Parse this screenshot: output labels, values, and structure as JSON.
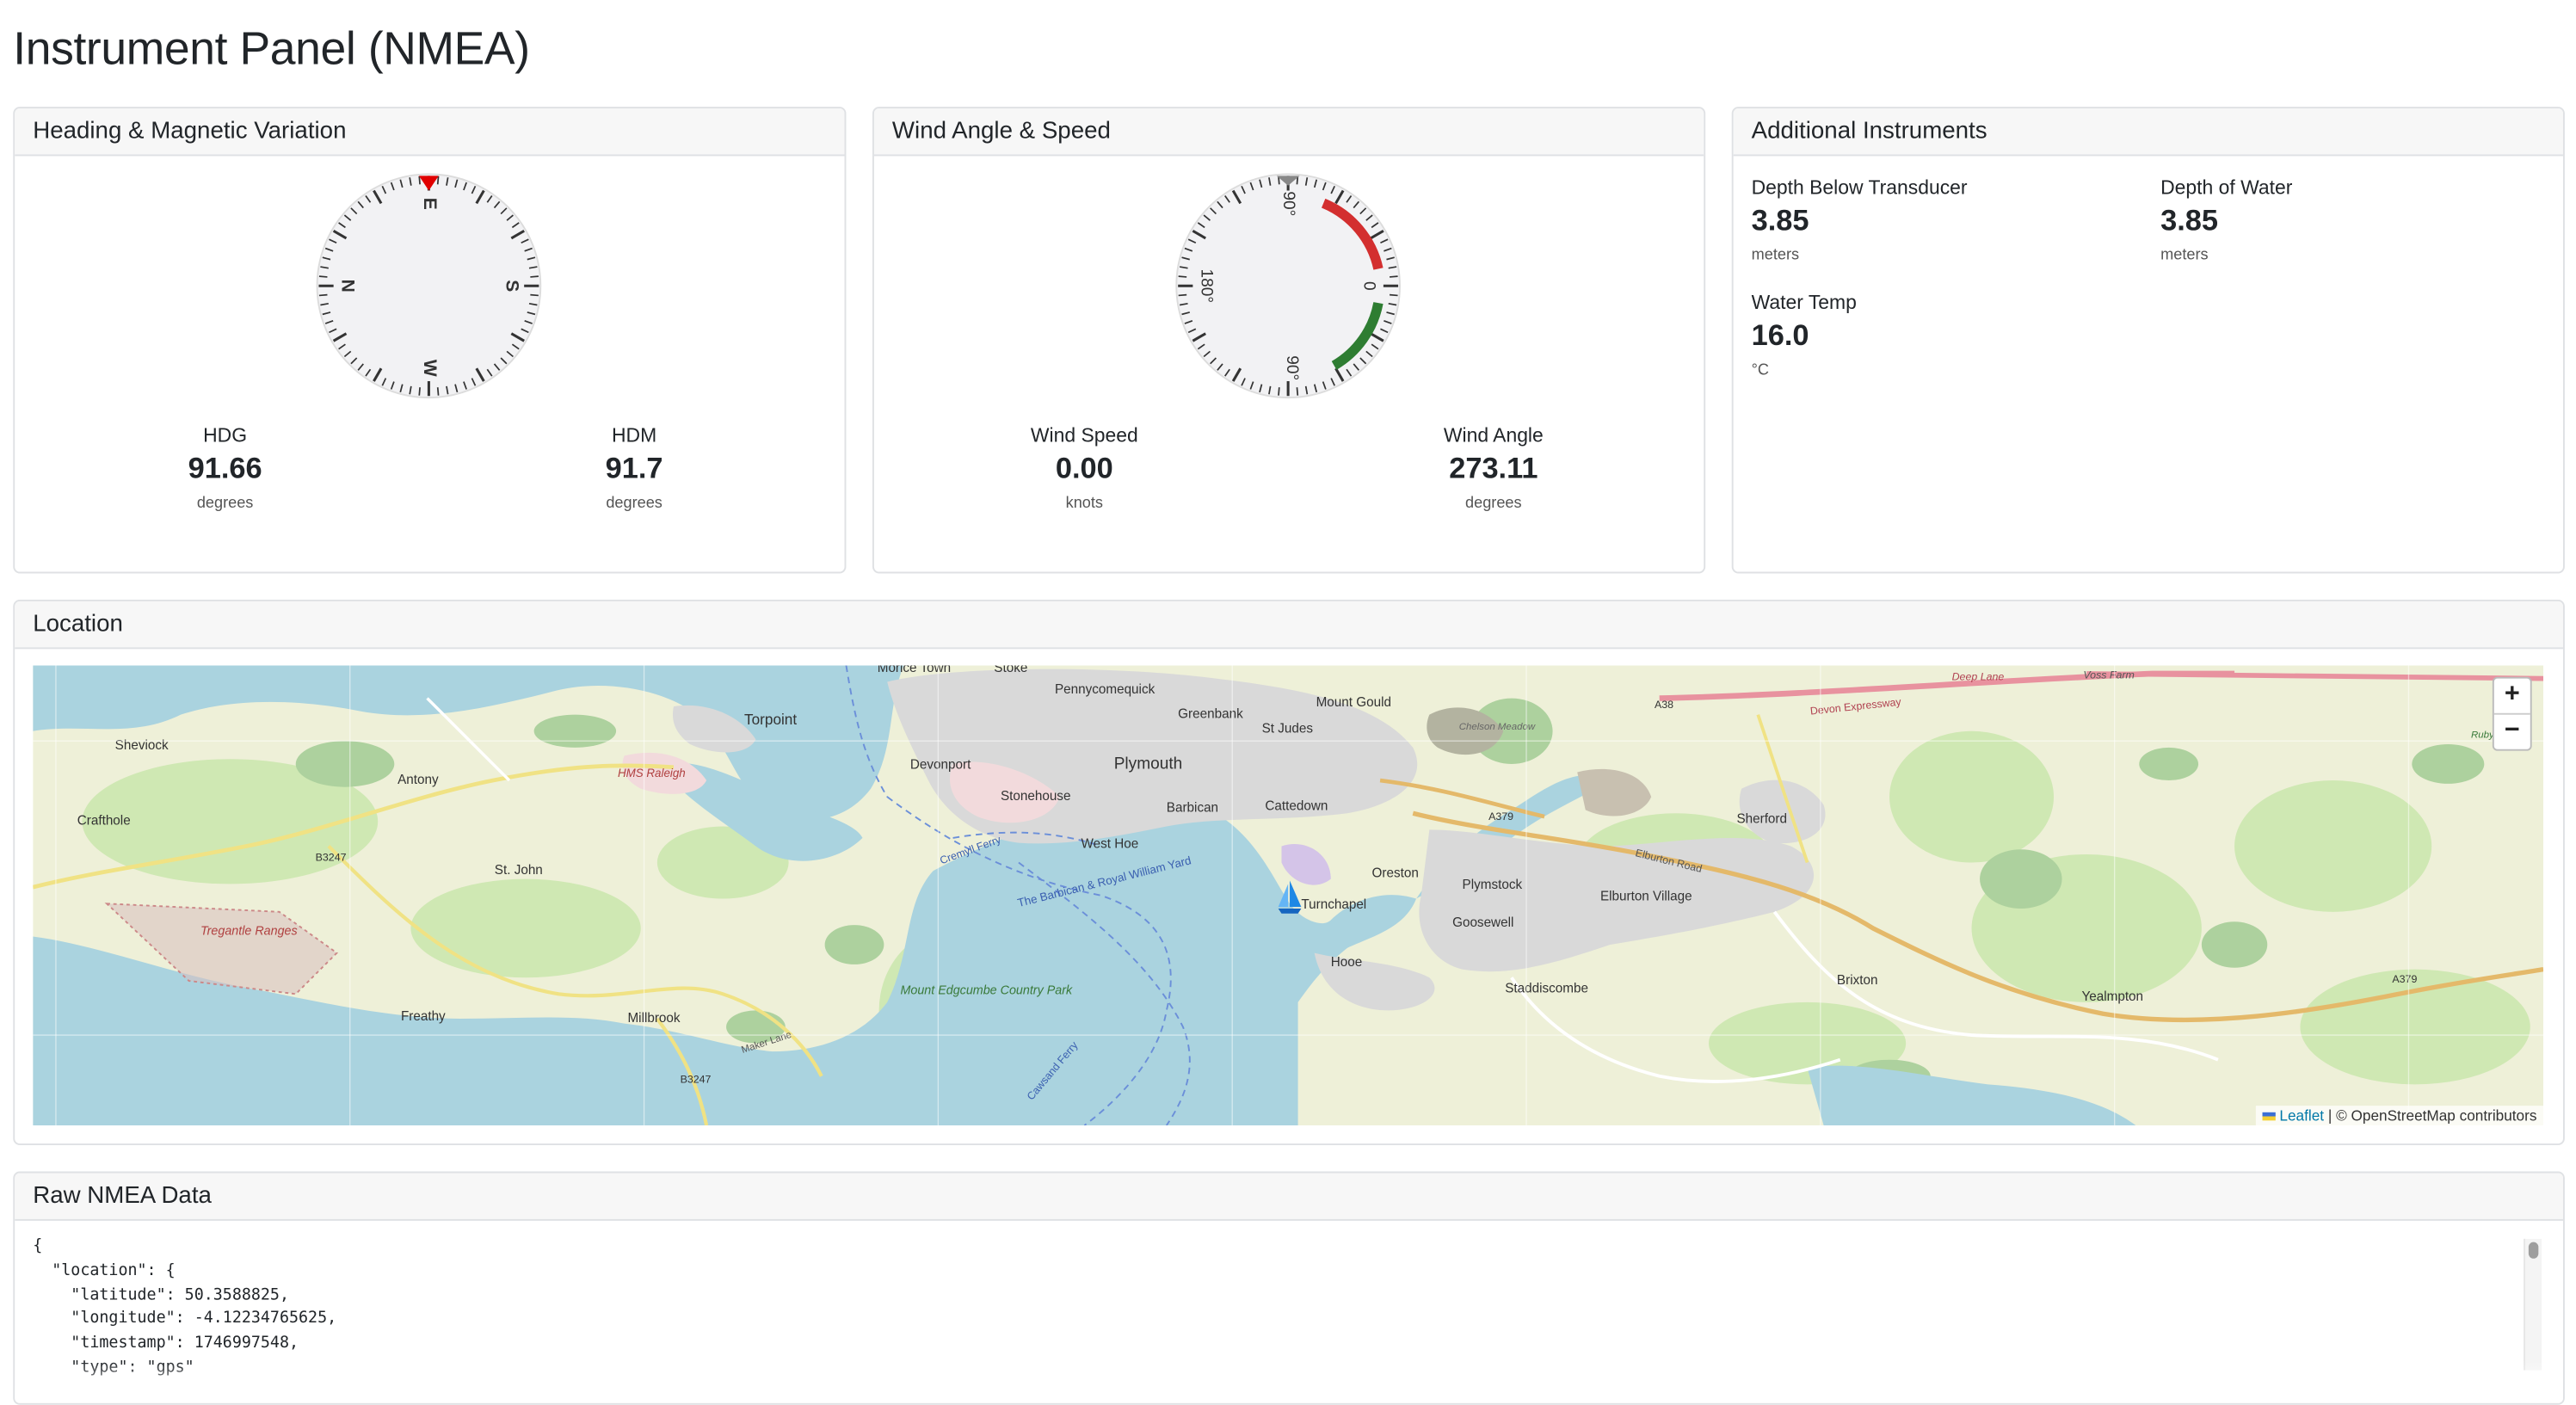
{
  "page": {
    "title": "Instrument Panel (NMEA)"
  },
  "heading_card": {
    "title": "Heading & Magnetic Variation",
    "compass_labels": {
      "north": "N",
      "east": "E",
      "south": "S",
      "west": "W"
    },
    "hdg": {
      "label": "HDG",
      "value": "91.66",
      "unit": "degrees"
    },
    "hdm": {
      "label": "HDM",
      "value": "91.7",
      "unit": "degrees"
    }
  },
  "wind_card": {
    "title": "Wind Angle & Speed",
    "dial_labels": {
      "top": "90°",
      "left": "180°",
      "bottom": "90°",
      "right": "0"
    },
    "speed": {
      "label": "Wind Speed",
      "value": "0.00",
      "unit": "knots"
    },
    "angle": {
      "label": "Wind Angle",
      "value": "273.11",
      "unit": "degrees"
    }
  },
  "additional_card": {
    "title": "Additional Instruments",
    "depth_below_transducer": {
      "label": "Depth Below Transducer",
      "value": "3.85",
      "unit": "meters"
    },
    "depth_of_water": {
      "label": "Depth of Water",
      "value": "3.85",
      "unit": "meters"
    },
    "water_temp": {
      "label": "Water Temp",
      "value": "16.0",
      "unit": "°C"
    }
  },
  "location_card": {
    "title": "Location",
    "zoom_in": "+",
    "zoom_out": "−",
    "attribution_link": "Leaflet",
    "attribution_text": "| © OpenStreetMap contributors",
    "places": {
      "morice_town": "Morice Town",
      "stoke": "Stoke",
      "pennycomequick": "Pennycomequick",
      "torpoint": "Torpoint",
      "mount_gould": "Mount Gould",
      "greenbank": "Greenbank",
      "st_judes": "St Judes",
      "sheviock": "Sheviock",
      "devonport": "Devonport",
      "plymouth": "Plymouth",
      "hms_raleigh": "HMS Raleigh",
      "antony": "Antony",
      "stonehouse": "Stonehouse",
      "barbican": "Barbican",
      "cattedown": "Cattedown",
      "crafthole": "Crafthole",
      "st_john": "St. John",
      "west_hoe": "West Hoe",
      "oreston": "Oreston",
      "plymstock": "Plymstock",
      "elburton_village": "Elburton Village",
      "sherford": "Sherford",
      "turnchapel": "Turnchapel",
      "goosewell": "Goosewell",
      "tregantle_ranges": "Tregantle Ranges",
      "hooe": "Hooe",
      "staddiscombe": "Staddiscombe",
      "brixton": "Brixton",
      "yealmpton": "Yealmpton",
      "freathy": "Freathy",
      "millbrook": "Millbrook",
      "mount_edgcumbe": "Mount Edgcumbe Country Park",
      "barbican_route": "The Barbican & Royal William Yard",
      "cremyll_ferry": "Cremyll Ferry",
      "cawsand_ferry": "Cawsand Ferry",
      "devon_expressway": "Devon Expressway",
      "deep_lane": "Deep Lane",
      "voss_farm": "Voss Farm",
      "chelson_meadow": "Chelson Meadow",
      "rubys_wood": "Ruby's Wood",
      "a38": "A38",
      "a379": "A379",
      "a379b": "A379",
      "b3247": "B3247",
      "b3247b": "B3247",
      "elburton_road": "Elburton Road",
      "maker_lane": "Maker Lane"
    }
  },
  "raw_card": {
    "title": "Raw NMEA Data",
    "json_text": "{\n  \"location\": {\n    \"latitude\": 50.3588825,\n    \"longitude\": -4.12234765625,\n    \"timestamp\": 1746997548,\n    \"type\": \"gps\""
  },
  "colors": {
    "port_arc": "#d32f2f",
    "starboard_arc": "#2e7d32",
    "compass_marker": "#e00000",
    "map_water": "#aad3df",
    "map_land": "#eef0d8",
    "map_urban": "#dddddd",
    "boat_marker": "#1565c0"
  },
  "icons": {
    "boat": "sailboat-icon"
  }
}
